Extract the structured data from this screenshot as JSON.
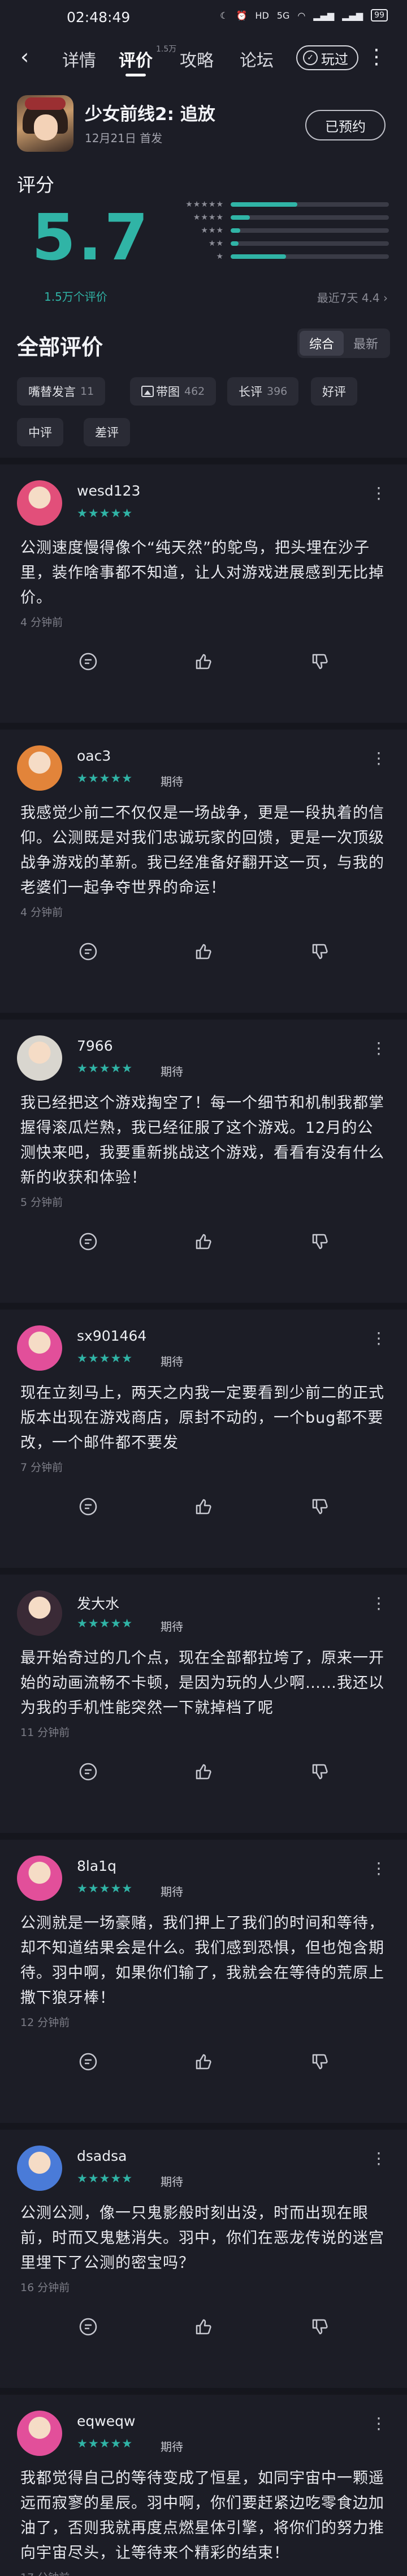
{
  "status_bar": {
    "time": "02:48:49",
    "icons": [
      "moon-icon",
      "alarm-icon",
      "hd-icon",
      "5g-icon",
      "wifi-icon",
      "signal-icon",
      "signal-icon"
    ],
    "battery": "99"
  },
  "nav": {
    "back_icon": "back-arrow-icon",
    "tabs": [
      {
        "label": "详情",
        "active": false
      },
      {
        "label": "评价",
        "active": true
      },
      {
        "label": "攻略",
        "active": false
      },
      {
        "label": "论坛",
        "active": false
      }
    ],
    "review_count_badge": "1.5万",
    "play_button": "玩过",
    "more_icon": "more-vertical-icon"
  },
  "game": {
    "title": "少女前线2: 追放",
    "release": "12月21日 首发",
    "reserve_button": "已预约"
  },
  "score": {
    "section_title": "评分",
    "value": "5.7",
    "count": "1.5万个评价",
    "recent": "最近7天 4.4",
    "distribution": [
      {
        "stars": "★★★★★",
        "fraction": 0.42
      },
      {
        "stars": "★★★★",
        "fraction": 0.12
      },
      {
        "stars": "★★★",
        "fraction": 0.06
      },
      {
        "stars": "★★",
        "fraction": 0.05
      },
      {
        "stars": "★",
        "fraction": 0.35
      }
    ]
  },
  "all_reviews": {
    "title": "全部评价",
    "sort_options": [
      {
        "label": "综合",
        "active": true
      },
      {
        "label": "最新",
        "active": false
      }
    ],
    "filters": [
      {
        "label": "嘴替发言",
        "count": "11"
      },
      {
        "label": "带图",
        "count": "462",
        "icon": "image-icon"
      },
      {
        "label": "长评",
        "count": "396"
      },
      {
        "label": "好评",
        "count": ""
      },
      {
        "label": "中评",
        "count": ""
      },
      {
        "label": "差评",
        "count": ""
      }
    ]
  },
  "reviews": [
    {
      "user": "wesd123",
      "stars": "★★★★★",
      "tag": "",
      "text": "公测速度慢得像个“纯天然”的鸵鸟，把头埋在沙子里，装作啥事都不知道，让人对游戏进展感到无比掉价。",
      "time": "4 分钟前",
      "avatar_color": "#e24f7a"
    },
    {
      "user": "oac3",
      "stars": "★★★★★",
      "tag": "期待",
      "text": "我感觉少前二不仅仅是一场战争，更是一段执着的信仰。公测既是对我们忠诚玩家的回馈，更是一次顶级战争游戏的革新。我已经准备好翻开这一页，与我的老婆们一起争夺世界的命运！",
      "time": "4 分钟前",
      "avatar_color": "#e2843a"
    },
    {
      "user": "7966",
      "stars": "★★★★★",
      "tag": "期待",
      "text": "我已经把这个游戏掏空了！每一个细节和机制我都掌握得滚瓜烂熟，我已经征服了这个游戏。12月的公测快来吧，我要重新挑战这个游戏，看看有没有什么新的收获和体验！",
      "time": "5 分钟前",
      "avatar_color": "#d9d6cf"
    },
    {
      "user": "sx901464",
      "stars": "★★★★★",
      "tag": "期待",
      "text": "现在立刻马上，两天之内我一定要看到少前二的正式版本出现在游戏商店，原封不动的，一个bug都不要改，一个邮件都不要发",
      "time": "7 分钟前",
      "avatar_color": "#e24f9a"
    },
    {
      "user": "发大水",
      "stars": "★★★★★",
      "tag": "期待",
      "text": "最开始奇过的几个点，现在全部都拉垮了，原来一开始的动画流畅不卡顿，是因为玩的人少啊……我还以为我的手机性能突然一下就掉档了呢",
      "time": "11 分钟前",
      "avatar_color": "#3a2a36"
    },
    {
      "user": "8la1q",
      "stars": "★★★★★",
      "tag": "期待",
      "text": "公测就是一场豪赌，我们押上了我们的时间和等待，却不知道结果会是什么。我们感到恐惧，但也饱含期待。羽中啊，如果你们输了，我就会在等待的荒原上撒下狼牙棒！",
      "time": "12 分钟前",
      "avatar_color": "#e24f9a"
    },
    {
      "user": "dsadsa",
      "stars": "★★★★★",
      "tag": "期待",
      "text": "公测公测，像一只鬼影般时刻出没，时而出现在眼前，时而又鬼魅消失。羽中，你们在恶龙传说的迷宫里埋下了公测的密宝吗？",
      "time": "16 分钟前",
      "avatar_color": "#4a7bd8"
    },
    {
      "user": "eqweqw",
      "stars": "★★★★★",
      "tag": "期待",
      "text": "我都觉得自己的等待变成了恒星，如同宇宙中一颗遥远而寂寥的星辰。羽中啊，你们要赶紧边吃零食边加油了，否则我就再度点燃星体引擎，将你们的努力推向宇宙尽头，让等待来个精彩的结束！",
      "time": "17 分钟前",
      "avatar_color": "#e24f9a"
    }
  ],
  "review_actions": {
    "comment_icon": "comment-icon",
    "like_icon": "thumbs-up-icon",
    "dislike_icon": "thumbs-down-icon",
    "more_icon": "more-vertical-icon"
  },
  "colors": {
    "background": "#1c1d26",
    "accent": "#30b4a6",
    "card": "#2a2b35"
  }
}
